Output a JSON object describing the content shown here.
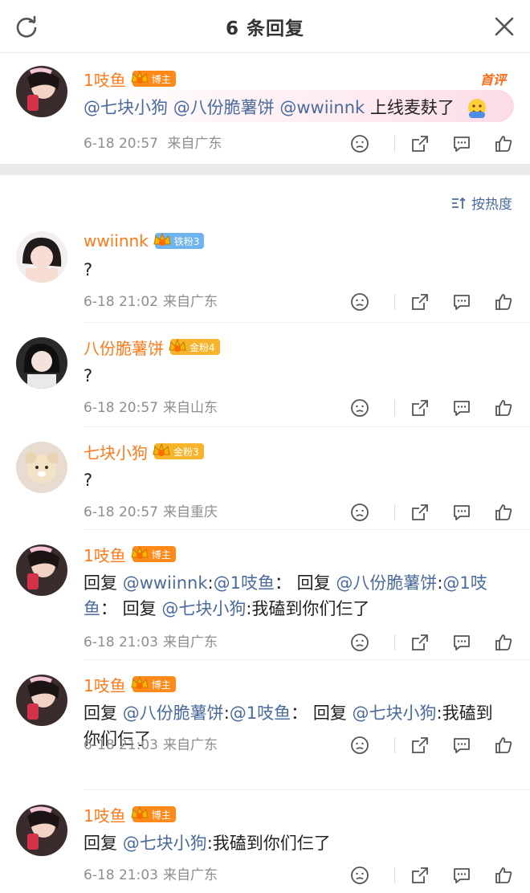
{
  "header": {
    "title": "6 条回复"
  },
  "first_tag": "首评",
  "sort_label": "按热度",
  "root": {
    "username": "1吱鱼",
    "badge": "博主",
    "mentions": [
      "@七块小狗",
      "@八份脆薯饼",
      "@wwiinnk"
    ],
    "text": "上线麦麸了",
    "time": "6-18 20:57",
    "location": "来自广东"
  },
  "replies": [
    {
      "username": "wwiinnk",
      "badge": "铁粉3",
      "badge_type": "iron",
      "text": "?",
      "time": "6-18 21:02",
      "location": "来自广东"
    },
    {
      "username": "八份脆薯饼",
      "badge": "金粉4",
      "badge_type": "gold",
      "text": "?",
      "time": "6-18 20:57",
      "location": "来自山东"
    },
    {
      "username": "七块小狗",
      "badge": "金粉3",
      "badge_type": "gold",
      "text": "?",
      "time": "6-18 20:57",
      "location": "来自重庆"
    },
    {
      "username": "1吱鱼",
      "badge": "博主",
      "badge_type": "blogger",
      "parts": [
        "回复 ",
        "@wwiinnk",
        ":",
        "@1吱鱼",
        "： 回复 ",
        "@八份脆薯饼",
        ":",
        "@1吱鱼",
        "： 回复 ",
        "@七块小狗",
        ":我磕到你们仨了"
      ],
      "time": "6-18 21:03",
      "location": "来自广东"
    },
    {
      "username": "1吱鱼",
      "badge": "博主",
      "badge_type": "blogger",
      "parts": [
        "回复 ",
        "@八份脆薯饼",
        ":",
        "@1吱鱼",
        "： 回复 ",
        "@七块小狗",
        ":我磕到你们仨了"
      ],
      "time": "6-18 21:03",
      "location": "来自广东"
    },
    {
      "username": "1吱鱼",
      "badge": "博主",
      "badge_type": "blogger",
      "parts": [
        "回复 ",
        "@七块小狗",
        ":我磕到你们仨了"
      ],
      "time": "6-18 21:03",
      "location": "来自广东"
    }
  ],
  "colors": {
    "username": "#ff7a1a",
    "mention": "#4a6b9c",
    "meta": "#8e8e8e"
  }
}
